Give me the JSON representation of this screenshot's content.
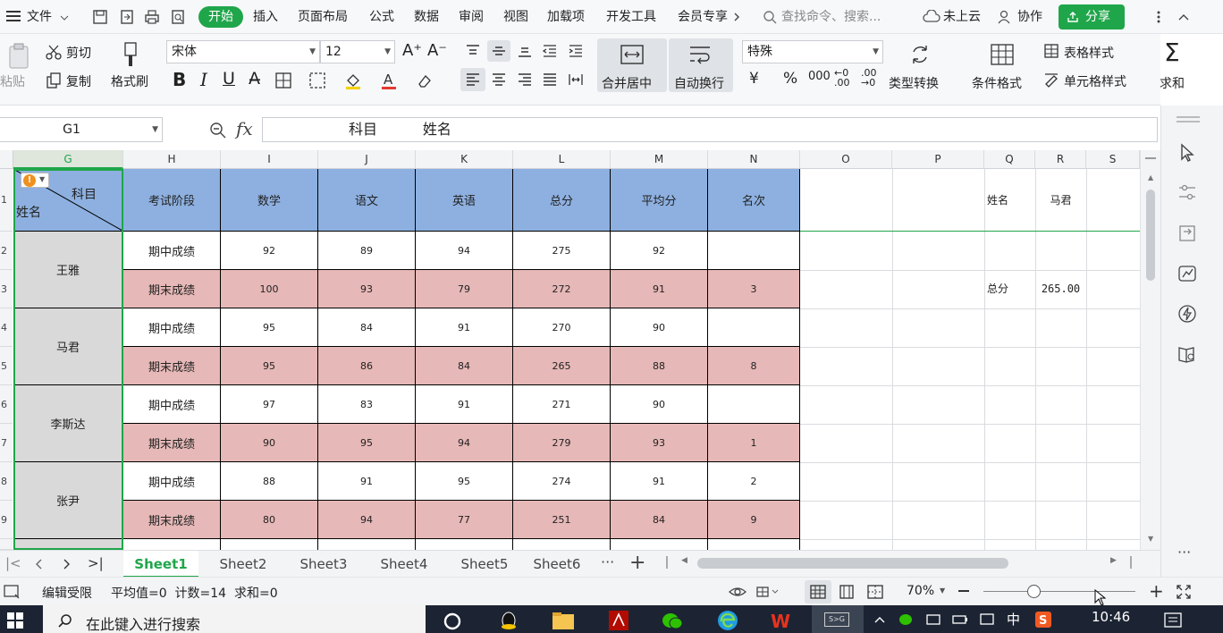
{
  "menubar": {
    "file": "文件",
    "tabs": [
      "开始",
      "插入",
      "页面布局",
      "公式",
      "数据",
      "审阅",
      "视图",
      "加载项",
      "开发工具",
      "会员专享"
    ],
    "search_placeholder": "查找命令、搜索...",
    "cloud": "未上云",
    "collab": "协作",
    "share": "分享"
  },
  "ribbon": {
    "paste": "粘贴",
    "cut": "剪切",
    "copy": "复制",
    "format_painter": "格式刷",
    "font_name": "宋体",
    "font_size": "12",
    "merge_center": "合并居中",
    "wrap_text": "自动换行",
    "number_format": "特殊",
    "type_convert": "类型转换",
    "cond_format": "条件格式",
    "table_style": "表格样式",
    "cell_style": "单元格样式",
    "sum": "求和"
  },
  "formula_bar": {
    "name_box": "G1",
    "fx": "fx",
    "content": "科目          姓名"
  },
  "columns": [
    "G",
    "H",
    "I",
    "J",
    "K",
    "L",
    "M",
    "N",
    "O",
    "P",
    "Q",
    "R",
    "S"
  ],
  "row_numbers": [
    "1",
    "2",
    "3",
    "4",
    "5",
    "6",
    "7",
    "8",
    "9"
  ],
  "table": {
    "corner_top": "科目",
    "corner_bottom": "姓名",
    "headers": [
      "考试阶段",
      "数学",
      "语文",
      "英语",
      "总分",
      "平均分",
      "名次"
    ],
    "students": [
      {
        "name": "王雅",
        "rows": [
          [
            "期中成绩",
            "92",
            "89",
            "94",
            "275",
            "92",
            ""
          ],
          [
            "期末成绩",
            "100",
            "93",
            "79",
            "272",
            "91",
            "3"
          ]
        ]
      },
      {
        "name": "马君",
        "rows": [
          [
            "期中成绩",
            "95",
            "84",
            "91",
            "270",
            "90",
            ""
          ],
          [
            "期末成绩",
            "95",
            "86",
            "84",
            "265",
            "88",
            "8"
          ]
        ]
      },
      {
        "name": "李斯达",
        "rows": [
          [
            "期中成绩",
            "97",
            "83",
            "91",
            "271",
            "90",
            ""
          ],
          [
            "期末成绩",
            "90",
            "95",
            "94",
            "279",
            "93",
            "1"
          ]
        ]
      },
      {
        "name": "张尹",
        "rows": [
          [
            "期中成绩",
            "88",
            "91",
            "95",
            "274",
            "91",
            "2"
          ],
          [
            "期末成绩",
            "80",
            "94",
            "77",
            "251",
            "84",
            "9"
          ]
        ]
      }
    ]
  },
  "lookup": {
    "name_label": "姓名",
    "name_value": "马君",
    "total_label": "总分",
    "total_value": "265.00"
  },
  "sheets": [
    "Sheet1",
    "Sheet2",
    "Sheet3",
    "Sheet4",
    "Sheet5",
    "Sheet6"
  ],
  "active_sheet": "Sheet1",
  "status": {
    "edit_mode": "编辑受限",
    "summary": "平均值=0  计数=14  求和=0",
    "zoom": "70%"
  },
  "taskbar": {
    "search_placeholder": "在此键入进行搜索",
    "ime": "中",
    "time": "10:46"
  },
  "colors": {
    "accent": "#1fa64a",
    "header_blue": "#8db0e0",
    "pink": "#e6b8b7",
    "name_gray": "#d9d9d9"
  }
}
